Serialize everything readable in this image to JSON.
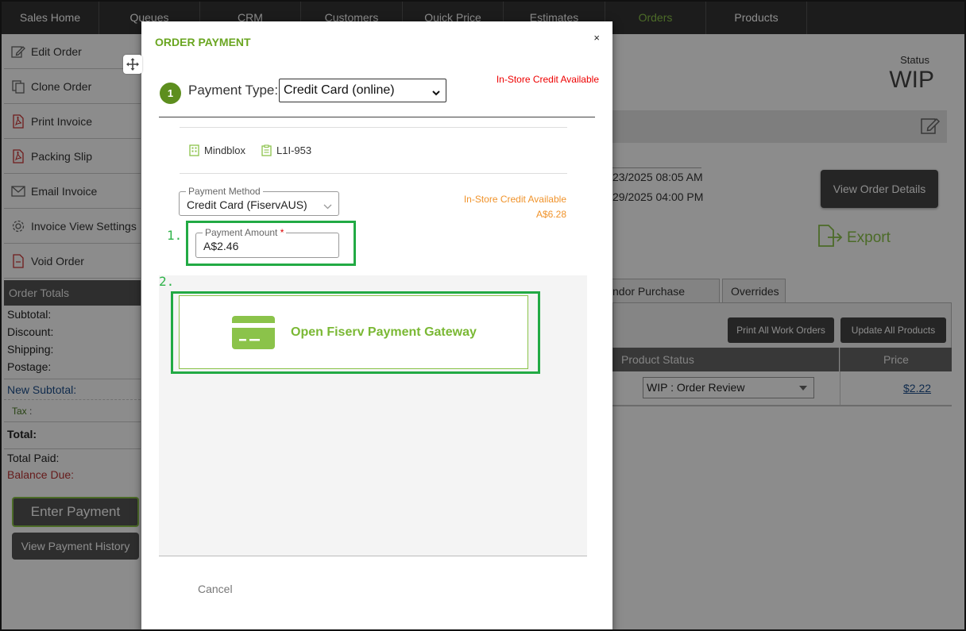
{
  "topnav": {
    "items": [
      {
        "label": "Sales Home"
      },
      {
        "label": "Queues"
      },
      {
        "label": "CRM"
      },
      {
        "label": "Customers"
      },
      {
        "label": "Quick Price"
      },
      {
        "label": "Estimates"
      },
      {
        "label": "Orders"
      },
      {
        "label": "Products"
      }
    ],
    "active": "Orders"
  },
  "sidebar": {
    "items": [
      {
        "label": "Edit Order",
        "icon": "edit-icon"
      },
      {
        "label": "Clone Order",
        "icon": "copy-icon"
      },
      {
        "label": "Print Invoice",
        "icon": "pdf-icon"
      },
      {
        "label": "Packing Slip",
        "icon": "pdf-icon"
      },
      {
        "label": "Email Invoice",
        "icon": "envelope-icon"
      },
      {
        "label": "Invoice View Settings",
        "icon": "gear-icon"
      },
      {
        "label": "Void Order",
        "icon": "document-icon"
      }
    ],
    "totals": {
      "heading": "Order Totals",
      "subtotal": "Subtotal:",
      "discount": "Discount:",
      "shipping": "Shipping:",
      "postage": "Postage:",
      "new_subtotal": "New Subtotal:",
      "tax": "Tax",
      "tax_colon": ":",
      "total": "Total:",
      "total_paid": "Total Paid:",
      "balance_due": "Balance Due:"
    },
    "enter_payment": "Enter Payment",
    "view_history": "View Payment History"
  },
  "main": {
    "status_label": "Status",
    "status_value": "WIP",
    "date1": "23/2025 08:05 AM",
    "date2": "29/2025 04:00 PM",
    "view_details": "View Order Details",
    "export": "Export",
    "tabs": [
      "ndor Purchase Order",
      "Overrides"
    ],
    "print_work_orders": "Print All Work Orders",
    "update_products": "Update All Products",
    "columns": [
      "Product Status",
      "Price"
    ],
    "row": {
      "status": "WIP : Order Review",
      "price": "$2.22"
    }
  },
  "modal": {
    "title": "ORDER PAYMENT",
    "close": "×",
    "step": "1",
    "payment_type_label": "Payment Type:",
    "payment_type_value": "Credit Card (online)",
    "credit_available_red": "In-Store Credit Available",
    "company": "Mindblox",
    "order_id": "L1I-953",
    "payment_method_legend": "Payment Method",
    "payment_method_value": "Credit Card (FiservAUS)",
    "credit_available": "In-Store Credit Available",
    "credit_amount": "A$6.28",
    "marker1": "1.",
    "marker2": "2.",
    "payment_amount_legend": "Payment Amount",
    "required_mark": "*",
    "payment_amount_value": "A$2.46",
    "gateway_button": "Open Fiserv Payment Gateway",
    "cancel": "Cancel"
  },
  "colors": {
    "accent_green": "#8bc34a",
    "title_green": "#6aa621",
    "highlight_green": "#22aa44",
    "credit_orange": "#f0932b",
    "credit_red": "#ee0000",
    "nav_bg": "#333333"
  }
}
